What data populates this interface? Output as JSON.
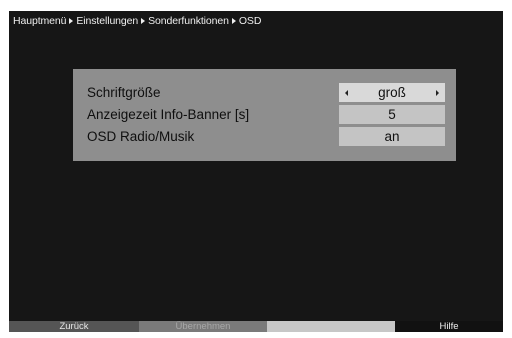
{
  "breadcrumb": [
    "Hauptmenü",
    "Einstellungen",
    "Sonderfunktionen",
    "OSD"
  ],
  "settings": [
    {
      "label": "Schriftgröße",
      "value": "groß"
    },
    {
      "label": "Anzeigezeit Info-Banner [s]",
      "value": "5"
    },
    {
      "label": "OSD Radio/Musik",
      "value": "an"
    }
  ],
  "footer": {
    "red": "Zurück",
    "green": "Übernehmen",
    "yellow": "",
    "blue": "Hilfe"
  },
  "colors": {
    "screen_bg": "#161616",
    "panel_bg": "#8e8e8e",
    "value_bg": "#c4c4c4"
  },
  "icons": [
    "breadcrumb-separator-icon",
    "arrow-left-icon",
    "arrow-right-icon"
  ]
}
